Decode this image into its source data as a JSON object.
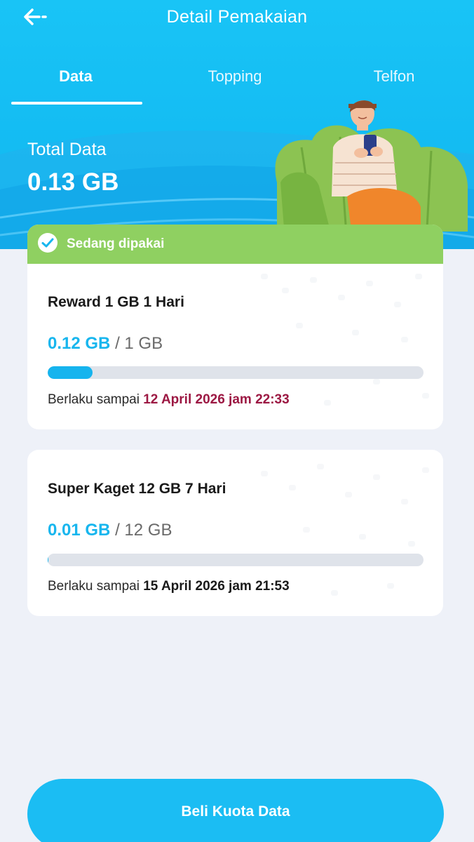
{
  "header": {
    "title": "Detail Pemakaian",
    "back_icon": "arrow-left-icon"
  },
  "tabs": [
    {
      "label": "Data",
      "active": true
    },
    {
      "label": "Topping",
      "active": false
    },
    {
      "label": "Telfon",
      "active": false
    }
  ],
  "summary": {
    "label": "Total Data",
    "value": "0.13 GB"
  },
  "packages": [
    {
      "status": "Sedang dipakai",
      "name": "Reward 1 GB 1 Hari",
      "used": "0.12 GB",
      "separator": "/",
      "total": "1 GB",
      "progress_fraction": 0.12,
      "valid_prefix": "Berlaku sampai",
      "valid_until": "12 April 2026 jam 22:33"
    },
    {
      "name": "Super Kaget 12 GB 7 Hari",
      "used": "0.01 GB",
      "separator": "/",
      "total": "12 GB",
      "progress_fraction": 0.001,
      "valid_prefix": "Berlaku sampai",
      "valid_until": "15 April 2026 jam 21:53"
    }
  ],
  "cta": {
    "label": "Beli Kuota Data"
  },
  "colors": {
    "header": "#19c4f6",
    "accent": "#18b6ee",
    "status_green": "#8fd061",
    "date_highlight": "#9c1843",
    "background": "#eef1f8"
  }
}
